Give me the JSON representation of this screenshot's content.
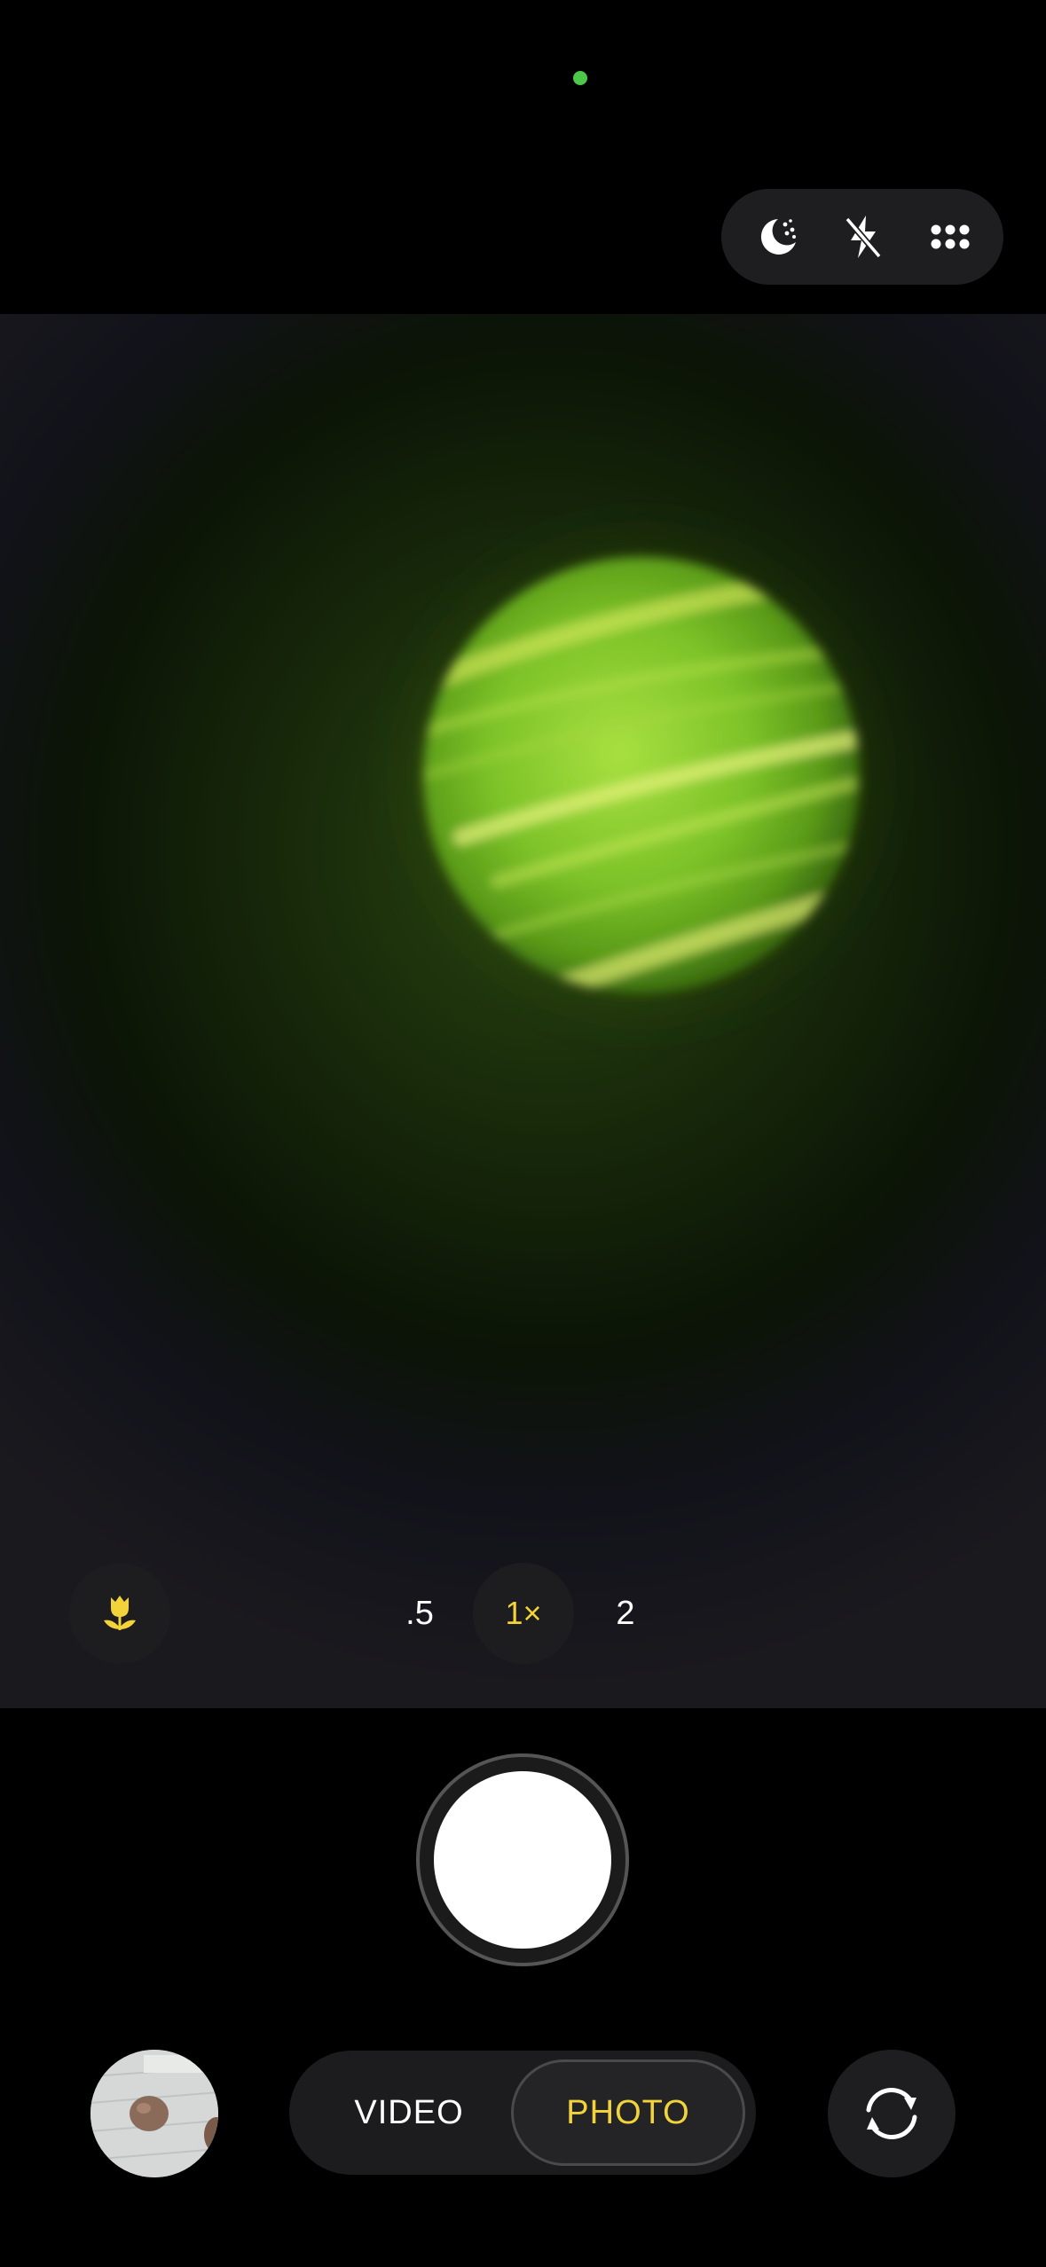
{
  "status": {
    "indicator_color": "#4cc74a"
  },
  "top_controls": {
    "night_mode": {
      "icon": "moon-stars-icon"
    },
    "flash": {
      "icon": "flash-off-icon"
    },
    "more": {
      "icon": "grid-dots-icon"
    }
  },
  "viewfinder": {
    "subject_color": "#9ad43a"
  },
  "macro": {
    "icon": "tulip-icon",
    "color": "#f2d33a"
  },
  "zoom": {
    "options": [
      ".5",
      "1×",
      "2"
    ],
    "selected": "1×"
  },
  "shutter": {
    "icon": "shutter-button"
  },
  "modes": {
    "video_label": "VIDEO",
    "photo_label": "PHOTO",
    "selected": "PHOTO"
  },
  "flip_camera": {
    "icon": "camera-switch-icon"
  },
  "colors": {
    "accent": "#f2d33a",
    "background": "#000000"
  }
}
